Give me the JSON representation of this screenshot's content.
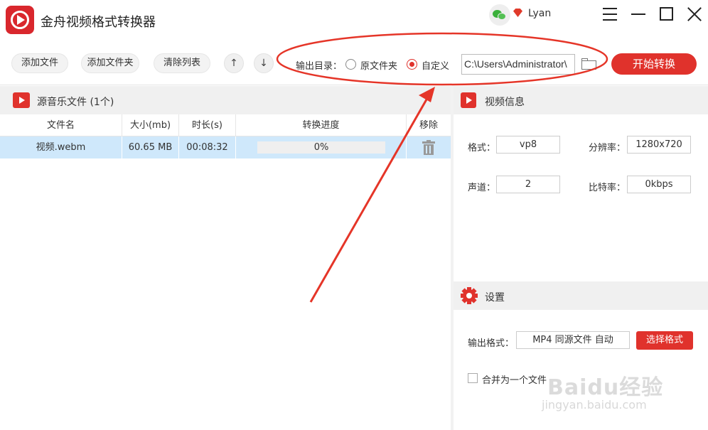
{
  "app": {
    "title": "金舟视频格式转换器",
    "user": "Lyan"
  },
  "toolbar": {
    "add_file": "添加文件",
    "add_folder": "添加文件夹",
    "clear_list": "清除列表",
    "up": "↑",
    "down": "↓",
    "output_dir_label": "输出目录：",
    "radio_source": "原文件夹",
    "radio_custom": "自定义",
    "output_path": "C:\\Users\\Administrator\\",
    "start": "开始转换"
  },
  "filelist": {
    "section_title": "源音乐文件 (1个)",
    "columns": [
      "文件名",
      "大小(mb)",
      "时长(s)",
      "转换进度",
      "移除"
    ],
    "rows": [
      {
        "name": "视频.webm",
        "size": "60.65 MB",
        "duration": "00:08:32",
        "progress_text": "0%",
        "progress": 0
      }
    ]
  },
  "video_info": {
    "title": "视频信息",
    "format_label": "格式：",
    "format": "vp8",
    "resolution_label": "分辨率：",
    "resolution": "1280x720",
    "channel_label": "声道：",
    "channel": "2",
    "bitrate_label": "比特率：",
    "bitrate": "0kbps"
  },
  "settings": {
    "title": "设置",
    "output_format_label": "输出格式：",
    "output_format": "MP4 同源文件 自动",
    "choose_format": "选择格式",
    "merge_label": "合并为一个文件"
  },
  "watermark": {
    "main": "Baidu经验",
    "sub": "jingyan.baidu.com"
  },
  "colors": {
    "accent": "#e0322c",
    "row_selected": "#cfe8fb",
    "annotation": "#e53528"
  }
}
